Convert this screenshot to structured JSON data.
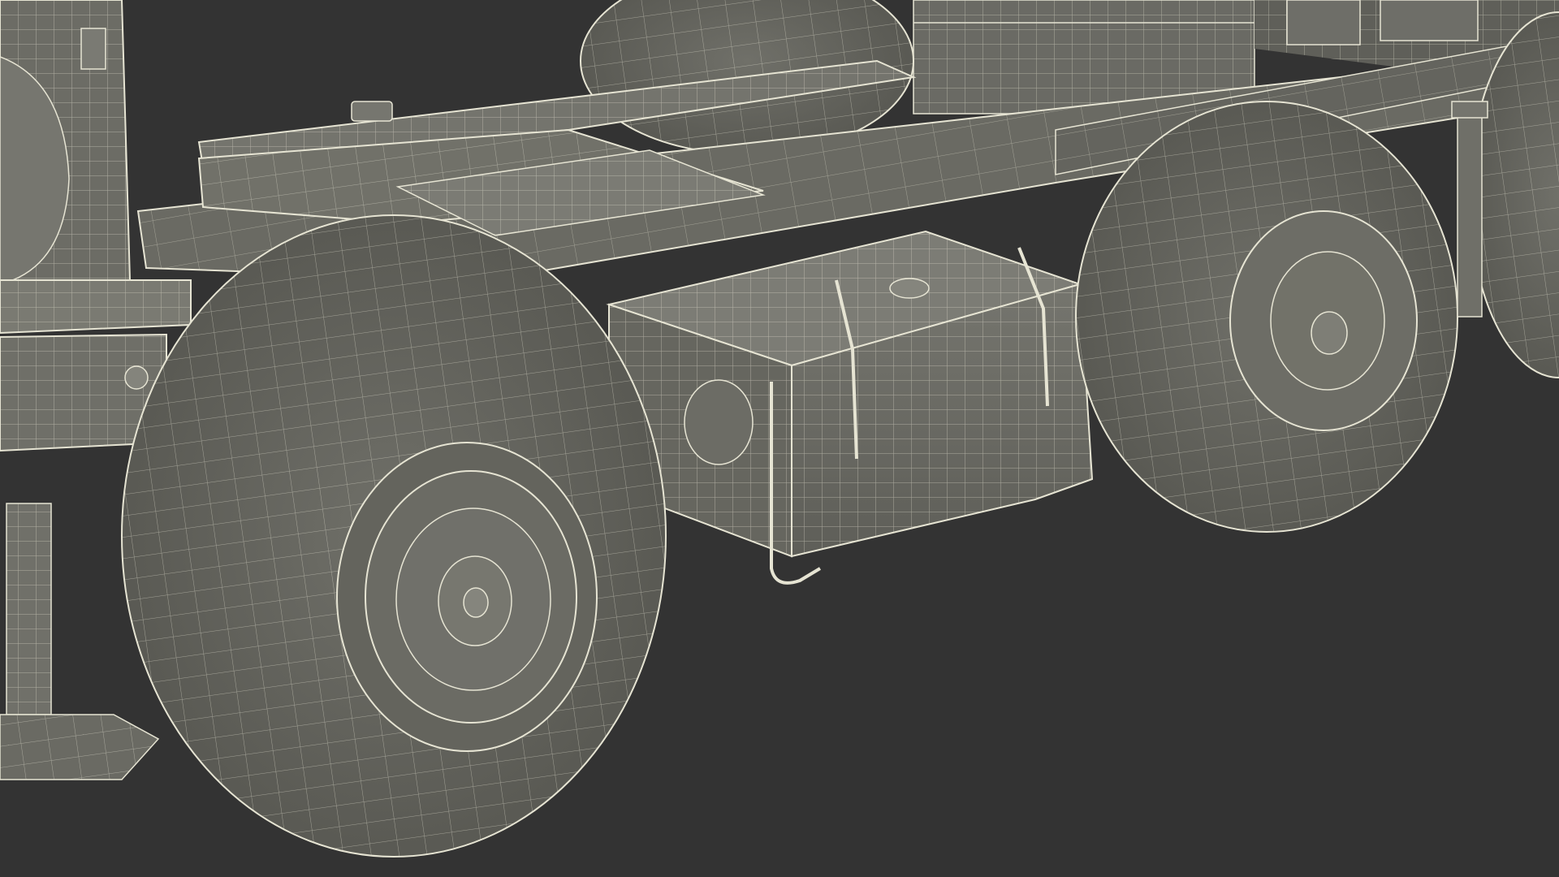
{
  "scene": {
    "background_color": "#333333",
    "model_fill_color": "#676761",
    "model_shadow_color": "#4f4f4a",
    "wire_color": "#e6e4d3",
    "render_mode": "wireframe-on-shaded"
  }
}
